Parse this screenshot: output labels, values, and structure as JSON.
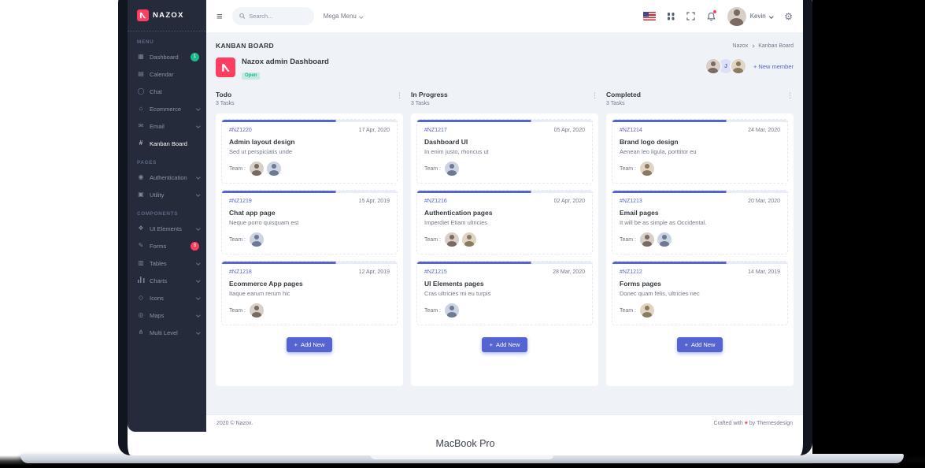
{
  "device": {
    "label": "MacBook Pro"
  },
  "colors": {
    "primary": "#5664d2",
    "danger": "#ff3d60",
    "success": "#1cbb8c",
    "sidebar_bg": "#252b3b"
  },
  "brand": "NAZOX",
  "navbar": {
    "search_placeholder": "Search...",
    "mega_menu": "Mega Menu",
    "user": "Kevin",
    "icons": [
      "menu-icon",
      "search-icon",
      "us-flag-icon",
      "apps-grid-icon",
      "fullscreen-icon",
      "bell-icon",
      "gear-icon"
    ]
  },
  "sidebar": {
    "items": [
      {
        "type": "section",
        "label": "MENU"
      },
      {
        "type": "item",
        "label": "Dashboard",
        "icon": "grid-icon",
        "badge": "1",
        "badge_color": "#1cbb8c"
      },
      {
        "type": "item",
        "label": "Calendar",
        "icon": "calendar-icon"
      },
      {
        "type": "item",
        "label": "Chat",
        "icon": "chat-icon"
      },
      {
        "type": "item",
        "label": "Ecommerce",
        "icon": "store-icon",
        "arrow": true
      },
      {
        "type": "item",
        "label": "Email",
        "icon": "mail-icon",
        "arrow": true
      },
      {
        "type": "item",
        "label": "Kanban Board",
        "icon": "kanban-icon",
        "active": true
      },
      {
        "type": "section",
        "label": "PAGES"
      },
      {
        "type": "item",
        "label": "Authentication",
        "icon": "user-circle-icon",
        "arrow": true
      },
      {
        "type": "item",
        "label": "Utility",
        "icon": "utility-icon",
        "arrow": true
      },
      {
        "type": "section",
        "label": "COMPONENTS"
      },
      {
        "type": "item",
        "label": "UI Elements",
        "icon": "ui-elements-icon",
        "arrow": true
      },
      {
        "type": "item",
        "label": "Forms",
        "icon": "pencil-icon",
        "badge": "8",
        "badge_color": "#ff3d60"
      },
      {
        "type": "item",
        "label": "Tables",
        "icon": "table-icon",
        "arrow": true
      },
      {
        "type": "item",
        "label": "Charts",
        "icon": "bar-chart-icon",
        "arrow": true
      },
      {
        "type": "item",
        "label": "Icons",
        "icon": "icons-icon",
        "arrow": true
      },
      {
        "type": "item",
        "label": "Maps",
        "icon": "map-pin-icon",
        "arrow": true
      },
      {
        "type": "item",
        "label": "Multi Level",
        "icon": "share-icon",
        "arrow": true
      }
    ]
  },
  "page": {
    "title": "KANBAN BOARD",
    "crumb1": "Nazox",
    "crumb2": "Kanban Board"
  },
  "project": {
    "name": "Nazox admin Dashboard",
    "status": "Open",
    "member_initial": "J",
    "add_member": "+ New member"
  },
  "labels": {
    "team": "Team :",
    "add_plus": "+"
  },
  "board": {
    "columns": [
      {
        "title": "Todo",
        "count": "3 Tasks",
        "add": "Add New",
        "cards": [
          {
            "id": "#NZ1220",
            "date": "17 Apr, 2020",
            "title": "Admin layout design",
            "desc": "Sed ut perspiciatis unde",
            "team_count": 2
          },
          {
            "id": "#NZ1219",
            "date": "15 Apr, 2019",
            "title": "Chat app page",
            "desc": "Neque porro quisquam est",
            "team_count": 1
          },
          {
            "id": "#NZ1218",
            "date": "12 Apr, 2019",
            "title": "Ecommerce App pages",
            "desc": "Itaque earum rerum hic",
            "team_count": 1
          }
        ]
      },
      {
        "title": "In Progress",
        "count": "3 Tasks",
        "add": "Add New",
        "cards": [
          {
            "id": "#NZ1217",
            "date": "05 Apr, 2020",
            "title": "Dashboard UI",
            "desc": "In enim justo, rhoncus ut",
            "team_count": 1
          },
          {
            "id": "#NZ1216",
            "date": "02 Apr, 2020",
            "title": "Authentication pages",
            "desc": "Imperdiet Etiam ultricies",
            "team_count": 2
          },
          {
            "id": "#NZ1215",
            "date": "28 Mar, 2020",
            "title": "UI Elements pages",
            "desc": "Cras ultricies mi eu turpis",
            "team_count": 1
          }
        ]
      },
      {
        "title": "Completed",
        "count": "3 Tasks",
        "add": "Add New",
        "cards": [
          {
            "id": "#NZ1214",
            "date": "24 Mar, 2020",
            "title": "Brand logo design",
            "desc": "Aenean leo ligula, porttitor eu",
            "team_count": 1
          },
          {
            "id": "#NZ1213",
            "date": "20 Mar, 2020",
            "title": "Email pages",
            "desc": "It will be as simple as Occidental.",
            "team_count": 2
          },
          {
            "id": "#NZ1212",
            "date": "14 Mar, 2019",
            "title": "Forms pages",
            "desc": "Donec quam felis, ultricies nec",
            "team_count": 1
          }
        ]
      }
    ]
  },
  "footer": {
    "copyright": "2020 © Nazox.",
    "credit_pre": "Crafted with",
    "heart": "♥",
    "credit_post": "by Themesdesign"
  }
}
